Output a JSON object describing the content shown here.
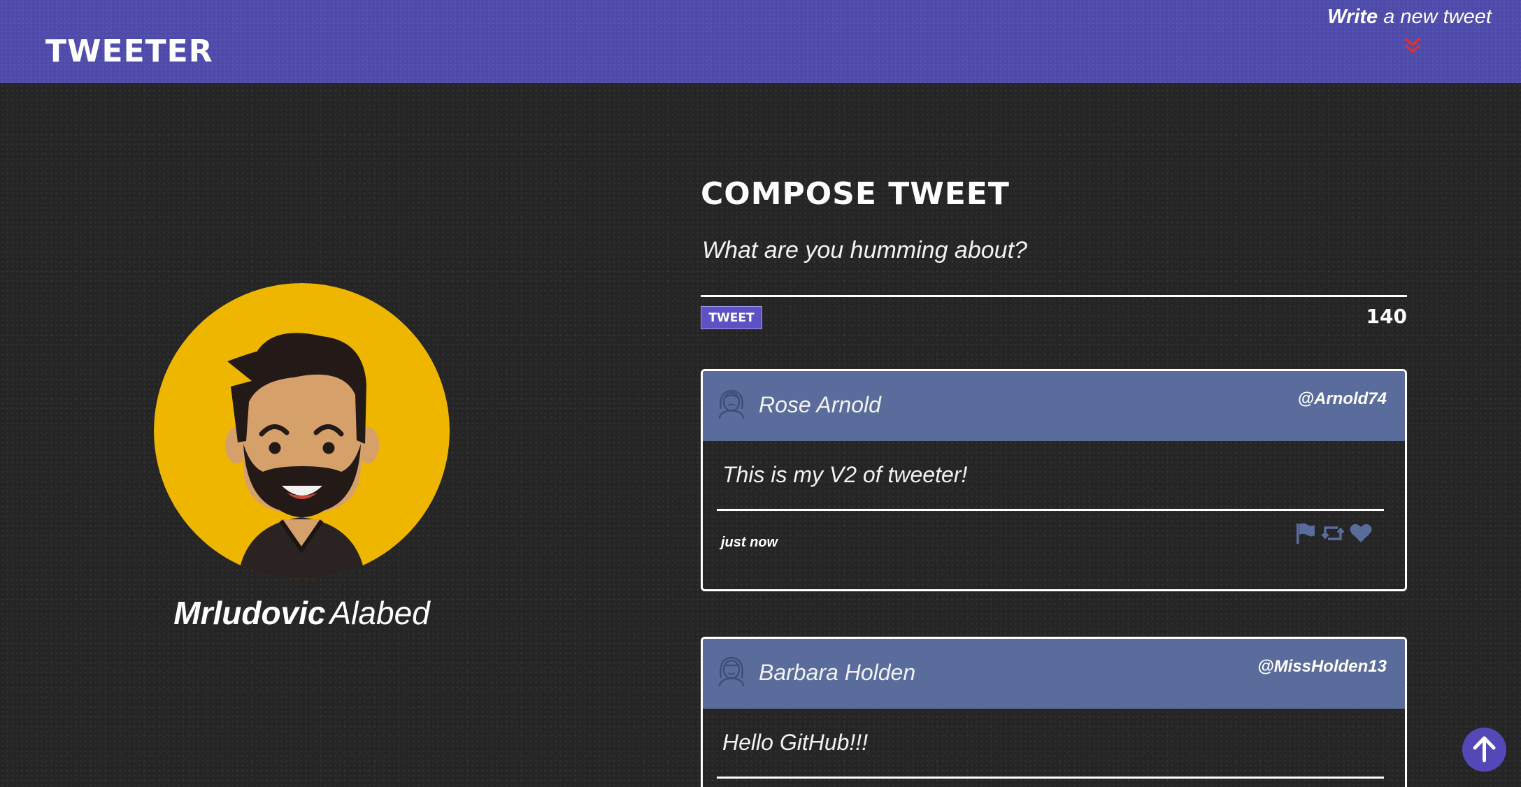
{
  "nav": {
    "brand": "TWEETER",
    "write_bold": "Write",
    "write_rest": "a new tweet",
    "chevron_icon": "double-chevron-down-icon",
    "chevron_color": "#e0312b"
  },
  "profile": {
    "first_name": "Mrludovic",
    "last_name": "Alabed",
    "avatar_icon": "bearded-man-avatar",
    "avatar_bg": "#efb600"
  },
  "compose": {
    "title": "COMPOSE TWEET",
    "placeholder": "What are you humming about?",
    "button_label": "TWEET",
    "counter": "140"
  },
  "tweets": [
    {
      "name": "Rose Arnold",
      "handle": "@Arnold74",
      "text": "This is my V2 of tweeter!",
      "time": "just now",
      "avatar_icon": "woman-avatar-icon"
    },
    {
      "name": "Barbara Holden",
      "handle": "@MissHolden13",
      "text": "Hello GitHub!!!",
      "time": "",
      "avatar_icon": "woman-avatar-icon"
    }
  ],
  "actions": [
    "flag-icon",
    "retweet-icon",
    "heart-icon"
  ],
  "scroll_top_icon": "arrow-up-icon",
  "colors": {
    "navbar": "#4f4bab",
    "tweet_header": "#596c9c",
    "button": "#5d51c4",
    "action_icons": "#596c9c"
  }
}
